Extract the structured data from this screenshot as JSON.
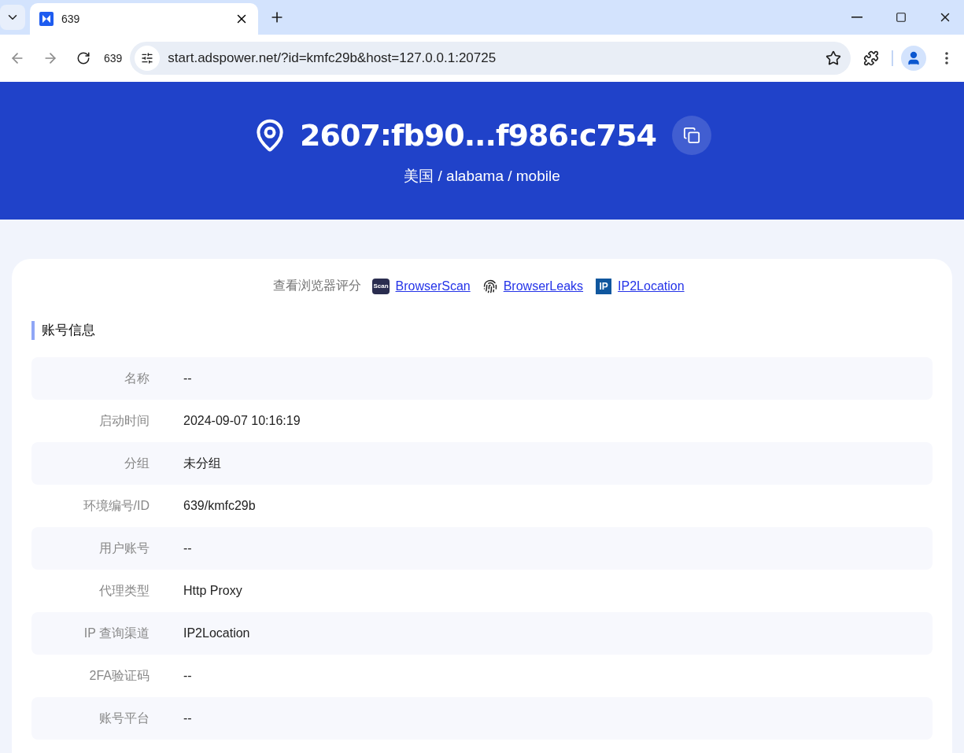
{
  "browser": {
    "tab": {
      "title": "639",
      "selected": true
    },
    "nav": {
      "tab_number": "639",
      "url": "start.adspower.net/?id=kmfc29b&host=127.0.0.1:20725"
    }
  },
  "header": {
    "ip": "2607:fb90...f986:c754",
    "location": "美国 / alabama / mobile"
  },
  "score": {
    "label": "查看浏览器评分",
    "links": [
      {
        "kind": "scan",
        "badge": "Scan",
        "text": "BrowserScan"
      },
      {
        "kind": "fingerprint",
        "text": "BrowserLeaks"
      },
      {
        "kind": "ip",
        "badge": "IP",
        "text": "IP2Location"
      }
    ]
  },
  "section": {
    "title": "账号信息",
    "rows": [
      {
        "label": "名称",
        "value": "--"
      },
      {
        "label": "启动时间",
        "value": "2024-09-07 10:16:19"
      },
      {
        "label": "分组",
        "value": "未分组"
      },
      {
        "label": "环境编号/ID",
        "value": "639/kmfc29b"
      },
      {
        "label": "用户账号",
        "value": "--"
      },
      {
        "label": "代理类型",
        "value": "Http Proxy"
      },
      {
        "label": "IP 查询渠道",
        "value": "IP2Location"
      },
      {
        "label": "2FA验证码",
        "value": "--"
      },
      {
        "label": "账号平台",
        "value": "--"
      }
    ]
  }
}
